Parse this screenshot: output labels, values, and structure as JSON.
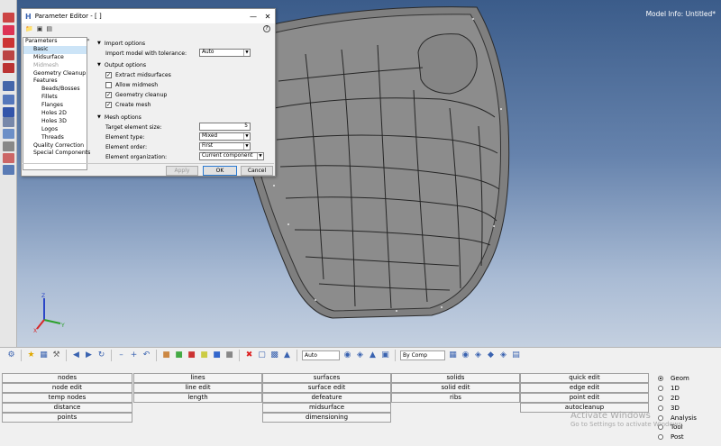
{
  "viewport": {
    "model_info": "Model Info: Untitled*"
  },
  "dialog": {
    "title": "Parameter Editor - [ ]",
    "tree": [
      {
        "label": "Parameters",
        "level": 0,
        "state": "normal"
      },
      {
        "label": "Basic",
        "level": 1,
        "state": "selected"
      },
      {
        "label": "Midsurface",
        "level": 1,
        "state": "normal"
      },
      {
        "label": "Midmesh",
        "level": 1,
        "state": "disabled"
      },
      {
        "label": "Geometry Cleanup",
        "level": 1,
        "state": "normal"
      },
      {
        "label": "Features",
        "level": 1,
        "state": "normal"
      },
      {
        "label": "Beads/Bosses",
        "level": 2,
        "state": "normal"
      },
      {
        "label": "Fillets",
        "level": 2,
        "state": "normal"
      },
      {
        "label": "Flanges",
        "level": 2,
        "state": "normal"
      },
      {
        "label": "Holes 2D",
        "level": 2,
        "state": "normal"
      },
      {
        "label": "Holes 3D",
        "level": 2,
        "state": "normal"
      },
      {
        "label": "Logos",
        "level": 2,
        "state": "normal"
      },
      {
        "label": "Threads",
        "level": 2,
        "state": "normal"
      },
      {
        "label": "Quality Correction",
        "level": 1,
        "state": "normal"
      },
      {
        "label": "Special Components",
        "level": 1,
        "state": "normal"
      }
    ],
    "import_options": {
      "header": "Import options",
      "tolerance_label": "Import model with tolerance:",
      "tolerance_value": "Auto"
    },
    "output_options": {
      "header": "Output options",
      "extract_midsurfaces": "Extract midsurfaces",
      "allow_midmesh": "Allow midmesh",
      "geometry_cleanup": "Geometry cleanup",
      "create_mesh": "Create mesh"
    },
    "mesh_options": {
      "header": "Mesh options",
      "target_size_label": "Target element size:",
      "target_size_value": "5",
      "element_type_label": "Element type:",
      "element_type_value": "Mixed",
      "element_order_label": "Element order:",
      "element_order_value": "First",
      "element_org_label": "Element organization:",
      "element_org_value": "Current component"
    },
    "buttons": {
      "apply": "Apply",
      "ok": "OK",
      "cancel": "Cancel"
    }
  },
  "toolbar": {
    "auto_combo": "Auto",
    "by_comp_combo": "By Comp"
  },
  "menu": {
    "col1": [
      "nodes",
      "node edit",
      "temp nodes",
      "distance",
      "points"
    ],
    "col2": [
      "lines",
      "line edit",
      "length"
    ],
    "col3": [
      "surfaces",
      "surface edit",
      "defeature",
      "midsurface",
      "dimensioning"
    ],
    "col4": [
      "solids",
      "solid edit",
      "ribs"
    ],
    "col5": [
      "quick edit",
      "edge edit",
      "point edit",
      "autocleanup"
    ],
    "radios": [
      "Geom",
      "1D",
      "2D",
      "3D",
      "Analysis",
      "Tool",
      "Post"
    ]
  },
  "watermark": {
    "line1": "Activate Windows",
    "line2": "Go to Settings to activate Windows."
  }
}
